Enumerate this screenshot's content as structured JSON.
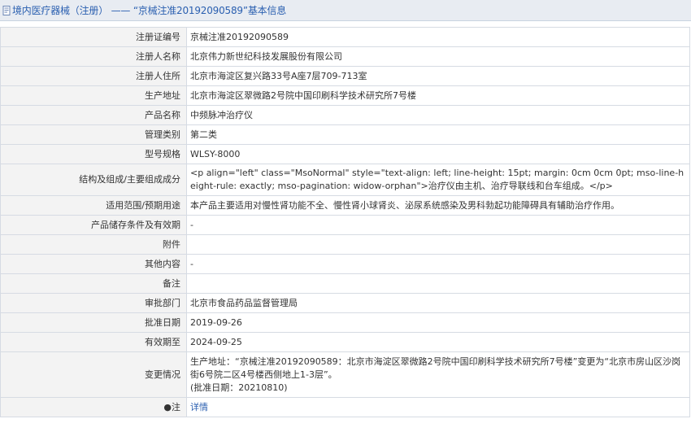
{
  "header": {
    "title": "境内医疗器械（注册） —— “京械注准20192090589”基本信息"
  },
  "rows": [
    {
      "label": "注册证编号",
      "value": "京械注准20192090589"
    },
    {
      "label": "注册人名称",
      "value": "北京伟力新世纪科技发展股份有限公司"
    },
    {
      "label": "注册人住所",
      "value": "北京市海淀区复兴路33号A座7层709-713室"
    },
    {
      "label": "生产地址",
      "value": "北京市海淀区翠微路2号院中国印刷科学技术研究所7号楼"
    },
    {
      "label": "产品名称",
      "value": "中频脉冲治疗仪"
    },
    {
      "label": "管理类别",
      "value": "第二类"
    },
    {
      "label": "型号规格",
      "value": "WLSY-8000"
    },
    {
      "label": "结构及组成/主要组成成分",
      "value": "<p align=\"left\" class=\"MsoNormal\" style=\"text-align: left; line-height: 15pt; margin: 0cm 0cm 0pt; mso-line-height-rule: exactly; mso-pagination: widow-orphan\">治疗仪由主机、治疗导联线和台车组成。</p>"
    },
    {
      "label": "适用范围/预期用途",
      "value": "本产品主要适用对慢性肾功能不全、慢性肾小球肾炎、泌尿系统感染及男科勃起功能障碍具有辅助治疗作用。"
    },
    {
      "label": "产品储存条件及有效期",
      "value": "-"
    },
    {
      "label": "附件",
      "value": ""
    },
    {
      "label": "其他内容",
      "value": "-"
    },
    {
      "label": "备注",
      "value": ""
    },
    {
      "label": "审批部门",
      "value": "北京市食品药品监督管理局"
    },
    {
      "label": "批准日期",
      "value": "2019-09-26"
    },
    {
      "label": "有效期至",
      "value": "2024-09-25"
    },
    {
      "label": "变更情况",
      "value_lines": [
        "生产地址：“京械注准20192090589：北京市海淀区翠微路2号院中国印刷科学技术研究所7号楼”变更为“北京市房山区沙岗街6号院二区4号楼西侧地上1-3层”。",
        "(批准日期：20210810)"
      ]
    },
    {
      "label": "●注",
      "value": "详情"
    }
  ]
}
